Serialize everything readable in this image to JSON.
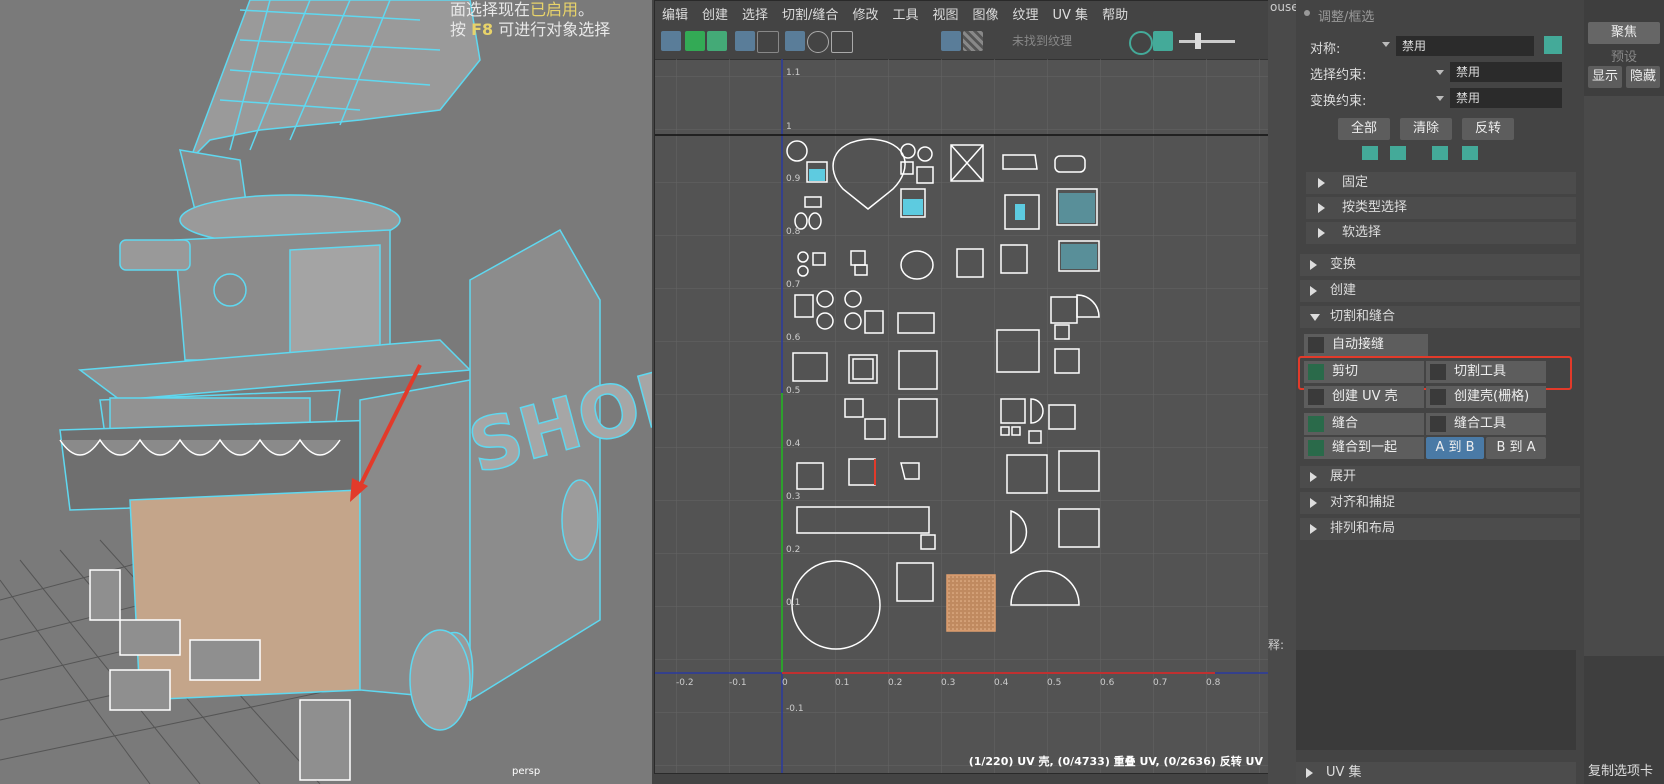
{
  "viewport": {
    "hud_line1_prefix": "面选择现在",
    "hud_line1_highlight": "已启用",
    "hud_line1_suffix": "。",
    "hud_line2_prefix": "按",
    "hud_line2_key": "F8",
    "hud_line2_suffix": "可进行对象选择",
    "camera_label": "persp",
    "shop_sign": "SHOP"
  },
  "uv_editor": {
    "menu": [
      "编辑",
      "创建",
      "选择",
      "切割/缝合",
      "修改",
      "工具",
      "视图",
      "图像",
      "纹理",
      "UV 集",
      "帮助"
    ],
    "texture_field": "未找到纹理",
    "status": "(1/220) UV 壳, (0/4733) 重叠 UV, (0/2636) 反转 UV",
    "axis_v_labels": [
      "1.1",
      "1",
      "0.9",
      "0.8",
      "0.7",
      "0.6",
      "0.5",
      "0.4",
      "0.3",
      "0.2",
      "0.1",
      "-0.1"
    ],
    "axis_u_labels": [
      "-0.2",
      "-0.1",
      "0",
      "0.1",
      "0.2",
      "0.3",
      "0.4",
      "0.5",
      "0.6",
      "0.7",
      "0.8"
    ]
  },
  "strip": {
    "top_text": "ouse",
    "comment_label": "释:"
  },
  "panel": {
    "header": "调整/框选",
    "symmetry_label": "对称:",
    "symmetry_value": "禁用",
    "select_constraint_label": "选择约束:",
    "select_constraint_value": "禁用",
    "transform_constraint_label": "变换约束:",
    "transform_constraint_value": "禁用",
    "btn_all": "全部",
    "btn_clear": "清除",
    "btn_invert": "反转",
    "sections_top": [
      "固定",
      "按类型选择",
      "软选择"
    ],
    "section_transform": "变换",
    "section_create": "创建",
    "section_cutsew": "切割和缝合",
    "tool_auto_seams": "自动接缝",
    "tool_cut": "剪切",
    "tool_cut_tool": "切割工具",
    "tool_create_uv_shell": "创建 UV 壳",
    "tool_create_shell_grid": "创建壳(栅格)",
    "tool_sew": "缝合",
    "tool_sew_tool": "缝合工具",
    "tool_sew_together": "缝合到一起",
    "tool_a_to_b": "A 到 B",
    "tool_b_to_a": "B 到 A",
    "sections_bottom": [
      "展开",
      "对齐和捕捉",
      "排列和布局"
    ],
    "section_uvset": "UV 集"
  },
  "far_right": {
    "btn_focus": "聚焦",
    "btn_preset": "预设",
    "btn_show": "显示",
    "btn_hide": "隐藏",
    "btn_copy_tab": "复制选项卡"
  },
  "colors": {
    "wire_cyan": "#5fd8f0",
    "highlight_red": "#e23a2a",
    "uv_bg": "#535353",
    "selected_orange": "#e0a070"
  }
}
